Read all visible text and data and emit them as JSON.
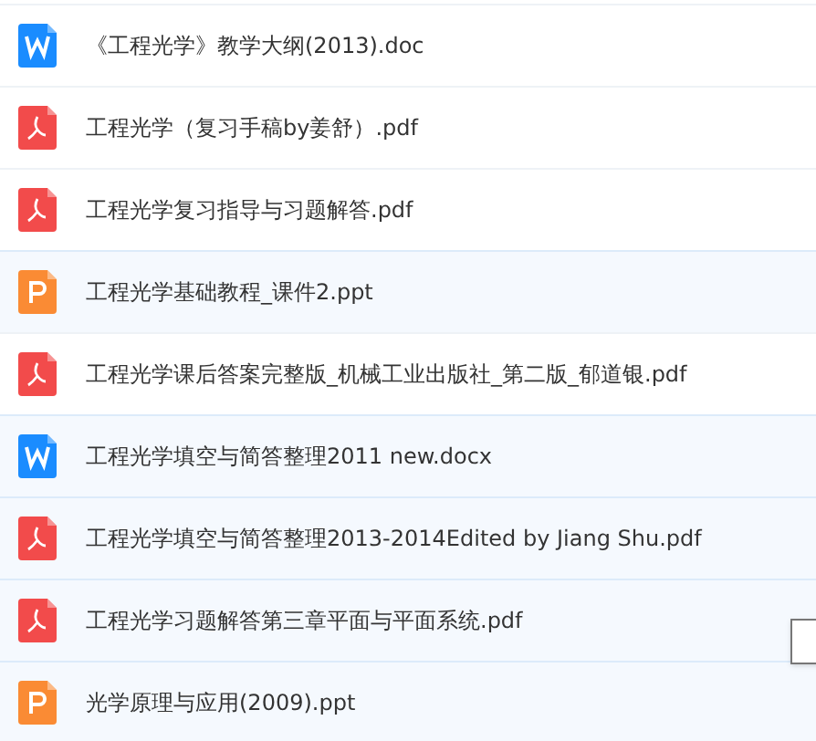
{
  "files": [
    {
      "kind": "word",
      "name": "《工程光学》教学大纲(2013).doc",
      "highlighted": false
    },
    {
      "kind": "pdf",
      "name": "工程光学（复习手稿by姜舒）.pdf",
      "highlighted": false
    },
    {
      "kind": "pdf",
      "name": "工程光学复习指导与习题解答.pdf",
      "highlighted": false
    },
    {
      "kind": "ppt",
      "name": "工程光学基础教程_课件2.ppt",
      "highlighted": true
    },
    {
      "kind": "pdf",
      "name": "工程光学课后答案完整版_机械工业出版社_第二版_郁道银.pdf",
      "highlighted": false
    },
    {
      "kind": "word",
      "name": "工程光学填空与简答整理2011 new.docx",
      "highlighted": true
    },
    {
      "kind": "pdf",
      "name": "工程光学填空与简答整理2013-2014Edited by Jiang Shu.pdf",
      "highlighted": true
    },
    {
      "kind": "pdf",
      "name": "工程光学习题解答第三章平面与平面系统.pdf",
      "highlighted": true
    },
    {
      "kind": "ppt",
      "name": "光学原理与应用(2009).ppt",
      "highlighted": true
    }
  ]
}
